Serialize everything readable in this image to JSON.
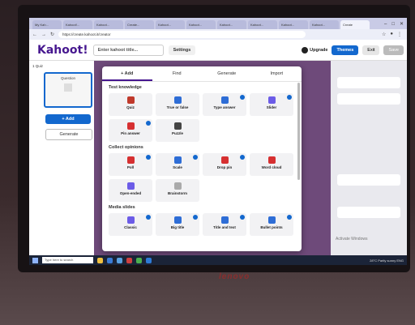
{
  "browser": {
    "tabs": [
      "My Kah...",
      "Kahoot!...",
      "Kahoot...",
      "Create...",
      "Kahoot...",
      "Kahoot...",
      "Kahoot...",
      "Kahoot...",
      "Kahoot...",
      "Kahoot...",
      "Create"
    ],
    "url": "https://create.kahoot.it/creator"
  },
  "header": {
    "logo": "Kahoot!",
    "title_placeholder": "Enter kahoot title...",
    "settings_label": "Settings",
    "upgrade_label": "Upgrade",
    "themes_label": "Themes",
    "exit_label": "Exit",
    "save_label": "Save"
  },
  "sidebar": {
    "quiz_label": "1  Quiz",
    "thumb_label": "Question",
    "add_label": "+ Add",
    "generate_label": "Generate"
  },
  "popup": {
    "tabs": [
      "+ Add",
      "Find",
      "Generate",
      "Import"
    ],
    "sections": [
      {
        "title": "Test knowledge",
        "items": [
          {
            "label": "Quiz",
            "color": "#c0392b",
            "badge": false
          },
          {
            "label": "True or false",
            "color": "#2e6dd6",
            "badge": false
          },
          {
            "label": "Type answer",
            "color": "#2e6dd6",
            "badge": true
          },
          {
            "label": "Slider",
            "color": "#6c5ce7",
            "badge": true
          },
          {
            "label": "Pin answer",
            "color": "#d63031",
            "badge": true
          },
          {
            "label": "Puzzle",
            "color": "#444444",
            "badge": false
          }
        ]
      },
      {
        "title": "Collect opinions",
        "items": [
          {
            "label": "Poll",
            "color": "#d63031",
            "badge": true
          },
          {
            "label": "Scale",
            "color": "#2e6dd6",
            "badge": true
          },
          {
            "label": "Drop pin",
            "color": "#d63031",
            "badge": true
          },
          {
            "label": "Word cloud",
            "color": "#d63031",
            "badge": false
          },
          {
            "label": "Open-ended",
            "color": "#6c5ce7",
            "badge": false
          },
          {
            "label": "Brainstorm",
            "color": "#aaaaaa",
            "badge": false
          }
        ]
      },
      {
        "title": "Media slides",
        "items": [
          {
            "label": "Classic",
            "color": "#6c5ce7",
            "badge": true
          },
          {
            "label": "Big title",
            "color": "#2e6dd6",
            "badge": true
          },
          {
            "label": "Title and text",
            "color": "#2e6dd6",
            "badge": true
          },
          {
            "label": "Bullet points",
            "color": "#2e6dd6",
            "badge": true
          }
        ]
      }
    ]
  },
  "taskbar": {
    "search_placeholder": "Type here to search",
    "tray": "28°C  Partly sunny  ENG"
  },
  "right_panel": {
    "activate": "Activate Windows"
  },
  "brand": "lenovo"
}
